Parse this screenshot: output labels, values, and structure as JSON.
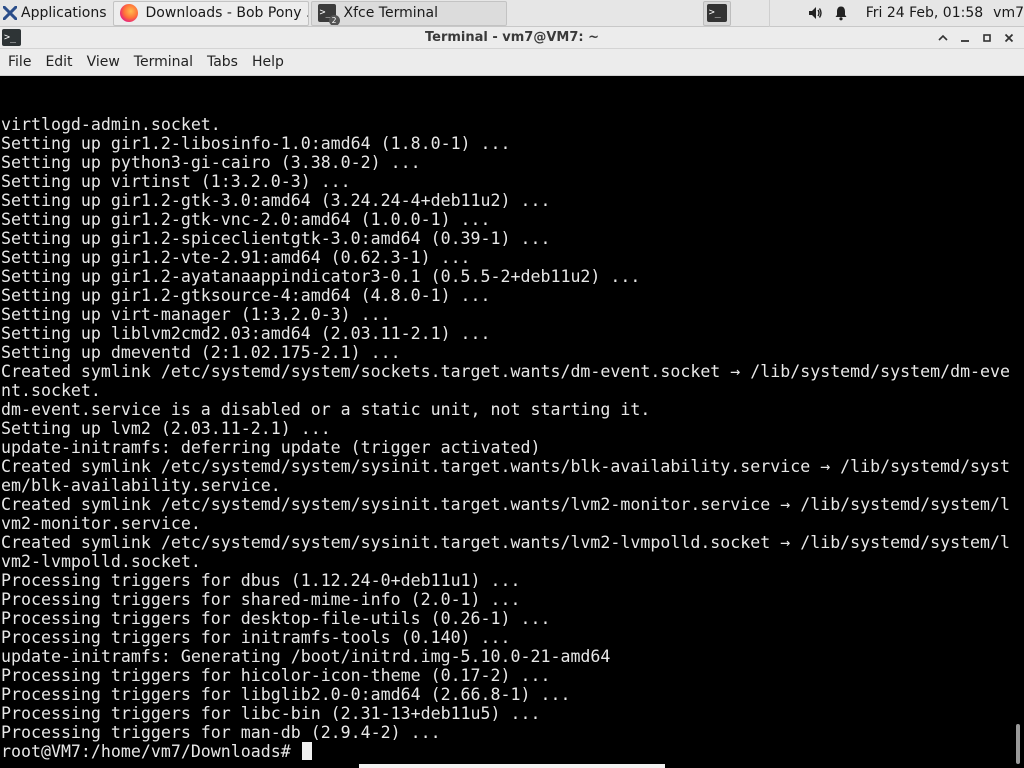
{
  "panel": {
    "applications_label": "Applications",
    "tasks": [
      {
        "title": "Downloads - Bob Pony ...",
        "icon": "firefox-icon"
      },
      {
        "title": "Xfce Terminal",
        "icon": "terminal-icon",
        "group_count": "2"
      }
    ],
    "clock": "Fri 24 Feb, 01:58",
    "user": "vm7"
  },
  "window": {
    "title": "Terminal - vm7@VM7: ~"
  },
  "menubar": {
    "items": [
      "File",
      "Edit",
      "View",
      "Terminal",
      "Tabs",
      "Help"
    ]
  },
  "terminal": {
    "lines": [
      "virtlogd-admin.socket.",
      "Setting up gir1.2-libosinfo-1.0:amd64 (1.8.0-1) ...",
      "Setting up python3-gi-cairo (3.38.0-2) ...",
      "Setting up virtinst (1:3.2.0-3) ...",
      "Setting up gir1.2-gtk-3.0:amd64 (3.24.24-4+deb11u2) ...",
      "Setting up gir1.2-gtk-vnc-2.0:amd64 (1.0.0-1) ...",
      "Setting up gir1.2-spiceclientgtk-3.0:amd64 (0.39-1) ...",
      "Setting up gir1.2-vte-2.91:amd64 (0.62.3-1) ...",
      "Setting up gir1.2-ayatanaappindicator3-0.1 (0.5.5-2+deb11u2) ...",
      "Setting up gir1.2-gtksource-4:amd64 (4.8.0-1) ...",
      "Setting up virt-manager (1:3.2.0-3) ...",
      "Setting up liblvm2cmd2.03:amd64 (2.03.11-2.1) ...",
      "Setting up dmeventd (2:1.02.175-2.1) ...",
      "Created symlink /etc/systemd/system/sockets.target.wants/dm-event.socket → /lib/systemd/system/dm-eve",
      "nt.socket.",
      "dm-event.service is a disabled or a static unit, not starting it.",
      "Setting up lvm2 (2.03.11-2.1) ...",
      "update-initramfs: deferring update (trigger activated)",
      "Created symlink /etc/systemd/system/sysinit.target.wants/blk-availability.service → /lib/systemd/syst",
      "em/blk-availability.service.",
      "Created symlink /etc/systemd/system/sysinit.target.wants/lvm2-monitor.service → /lib/systemd/system/l",
      "vm2-monitor.service.",
      "Created symlink /etc/systemd/system/sysinit.target.wants/lvm2-lvmpolld.socket → /lib/systemd/system/l",
      "vm2-lvmpolld.socket.",
      "Processing triggers for dbus (1.12.24-0+deb11u1) ...",
      "Processing triggers for shared-mime-info (2.0-1) ...",
      "Processing triggers for desktop-file-utils (0.26-1) ...",
      "Processing triggers for initramfs-tools (0.140) ...",
      "update-initramfs: Generating /boot/initrd.img-5.10.0-21-amd64",
      "Processing triggers for hicolor-icon-theme (0.17-2) ...",
      "Processing triggers for libglib2.0-0:amd64 (2.66.8-1) ...",
      "Processing triggers for libc-bin (2.31-13+deb11u5) ...",
      "Processing triggers for man-db (2.9.4-2) ..."
    ],
    "prompt": "root@VM7:/home/vm7/Downloads# "
  },
  "colors": {
    "terminal_bg": "#000000",
    "terminal_fg": "#e8e8e8",
    "panel_bg": "#e6e6e6"
  }
}
